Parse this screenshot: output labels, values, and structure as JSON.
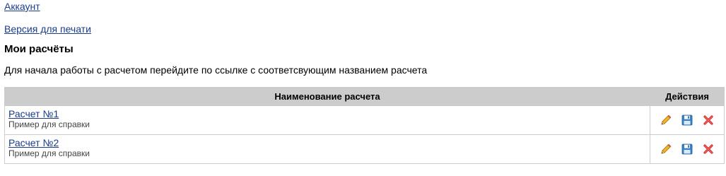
{
  "nav": {
    "account_label": "Аккаунт",
    "print_label": "Версия для печати"
  },
  "page": {
    "title": "Мои расчёты",
    "intro": "Для начала работы с расчетом перейдите по ссылке с соответсвующим названием расчета"
  },
  "table": {
    "headers": {
      "name": "Наименование расчета",
      "actions": "Действия"
    },
    "rows": [
      {
        "name": "Расчет №1",
        "description": "Пример для справки"
      },
      {
        "name": "Расчет №2",
        "description": "Пример для справки"
      }
    ],
    "row_actions": [
      "pencil-icon",
      "floppy-disk-icon",
      "delete-x-icon"
    ]
  },
  "colors": {
    "link": "#1a3c8c",
    "header_bg": "#cccccc",
    "border": "#cccccc",
    "pencil": "#e8a317",
    "save": "#3b82c4",
    "delete": "#d92b2b"
  }
}
